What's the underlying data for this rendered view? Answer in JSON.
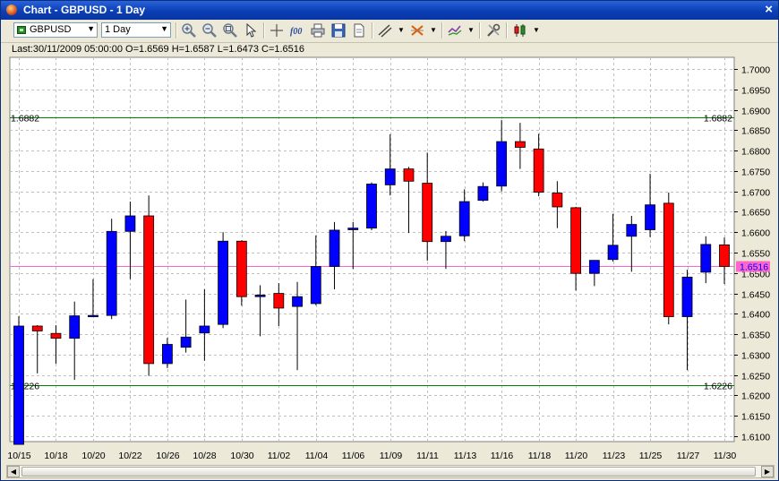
{
  "window": {
    "title": "Chart - GBPUSD - 1 Day",
    "close_label": "×"
  },
  "toolbar": {
    "symbol": "GBPUSD",
    "period": "1 Day",
    "tools": [
      "zoom-in-icon",
      "zoom-out-icon",
      "zoom-fit-icon",
      "cursor-pointer-icon",
      "crosshair-icon",
      "function-icon",
      "print-icon",
      "save-icon",
      "document-icon",
      "trendline-icon",
      "fibonacci-icon",
      "indicators-icon",
      "settings-icon",
      "chart-type-icon"
    ]
  },
  "info": {
    "text": "Last:30/11/2009 05:00:00 O=1.6569 H=1.6587 L=1.6473 C=1.6516"
  },
  "colors": {
    "bull": "#0000ff",
    "bear": "#ff0000",
    "hline": "#008000",
    "price_line": "#ff66cc",
    "price_label_bg": "#ff66cc",
    "price_label_text": "#0000ff",
    "grid": "#c0c0c0"
  },
  "chart_data": {
    "type": "candlestick",
    "symbol": "GBPUSD",
    "period": "1 Day",
    "ylim": [
      1.6082,
      1.7035
    ],
    "yticks": [
      "1.7000",
      "1.6950",
      "1.6900",
      "1.6850",
      "1.6800",
      "1.6750",
      "1.6700",
      "1.6650",
      "1.6600",
      "1.6550",
      "1.6500",
      "1.6450",
      "1.6400",
      "1.6350",
      "1.6300",
      "1.6250",
      "1.6200",
      "1.6150",
      "1.6100"
    ],
    "xlabels": [
      "10/15",
      "10/18",
      "10/20",
      "10/22",
      "10/26",
      "10/28",
      "10/30",
      "11/02",
      "11/04",
      "11/06",
      "11/09",
      "11/11",
      "11/13",
      "11/16",
      "11/18",
      "11/20",
      "11/23",
      "11/25",
      "11/27",
      "11/30"
    ],
    "horizontal_lines": [
      {
        "value": 1.6882,
        "label": "1.6882"
      },
      {
        "value": 1.6226,
        "label": "1.6226"
      }
    ],
    "last_price": {
      "value": 1.6516,
      "label": "1.6516"
    },
    "candles": [
      {
        "o": 1.608,
        "h": 1.6394,
        "l": 1.608,
        "c": 1.637
      },
      {
        "o": 1.637,
        "h": 1.6372,
        "l": 1.6254,
        "c": 1.6358
      },
      {
        "o": 1.6352,
        "h": 1.6372,
        "l": 1.6278,
        "c": 1.634
      },
      {
        "o": 1.634,
        "h": 1.643,
        "l": 1.6238,
        "c": 1.6395
      },
      {
        "o": 1.6394,
        "h": 1.6485,
        "l": 1.6394,
        "c": 1.6396
      },
      {
        "o": 1.6396,
        "h": 1.6633,
        "l": 1.6387,
        "c": 1.6602
      },
      {
        "o": 1.6602,
        "h": 1.6675,
        "l": 1.6485,
        "c": 1.664
      },
      {
        "o": 1.664,
        "h": 1.669,
        "l": 1.6248,
        "c": 1.6278
      },
      {
        "o": 1.6278,
        "h": 1.6341,
        "l": 1.6267,
        "c": 1.6325
      },
      {
        "o": 1.6318,
        "h": 1.6435,
        "l": 1.6305,
        "c": 1.6343
      },
      {
        "o": 1.6353,
        "h": 1.646,
        "l": 1.6285,
        "c": 1.637
      },
      {
        "o": 1.6374,
        "h": 1.66,
        "l": 1.6365,
        "c": 1.6578
      },
      {
        "o": 1.6578,
        "h": 1.658,
        "l": 1.642,
        "c": 1.6442
      },
      {
        "o": 1.6442,
        "h": 1.647,
        "l": 1.6345,
        "c": 1.6446
      },
      {
        "o": 1.645,
        "h": 1.6475,
        "l": 1.637,
        "c": 1.6414
      },
      {
        "o": 1.6418,
        "h": 1.6478,
        "l": 1.6262,
        "c": 1.6442
      },
      {
        "o": 1.6425,
        "h": 1.6592,
        "l": 1.6421,
        "c": 1.6516
      },
      {
        "o": 1.6516,
        "h": 1.6625,
        "l": 1.646,
        "c": 1.6605
      },
      {
        "o": 1.6606,
        "h": 1.6625,
        "l": 1.651,
        "c": 1.661
      },
      {
        "o": 1.661,
        "h": 1.6722,
        "l": 1.6605,
        "c": 1.6718
      },
      {
        "o": 1.6716,
        "h": 1.684,
        "l": 1.669,
        "c": 1.6755
      },
      {
        "o": 1.6755,
        "h": 1.676,
        "l": 1.6598,
        "c": 1.6725
      },
      {
        "o": 1.672,
        "h": 1.6795,
        "l": 1.653,
        "c": 1.6577
      },
      {
        "o": 1.6577,
        "h": 1.6603,
        "l": 1.651,
        "c": 1.659
      },
      {
        "o": 1.6591,
        "h": 1.6705,
        "l": 1.6578,
        "c": 1.6675
      },
      {
        "o": 1.6678,
        "h": 1.6722,
        "l": 1.6675,
        "c": 1.6712
      },
      {
        "o": 1.6713,
        "h": 1.6875,
        "l": 1.67,
        "c": 1.6822
      },
      {
        "o": 1.6822,
        "h": 1.6868,
        "l": 1.6755,
        "c": 1.6808
      },
      {
        "o": 1.6804,
        "h": 1.6841,
        "l": 1.6688,
        "c": 1.6698
      },
      {
        "o": 1.6696,
        "h": 1.6725,
        "l": 1.661,
        "c": 1.6662
      },
      {
        "o": 1.666,
        "h": 1.6662,
        "l": 1.6457,
        "c": 1.6499
      },
      {
        "o": 1.6499,
        "h": 1.653,
        "l": 1.6468,
        "c": 1.6531
      },
      {
        "o": 1.6533,
        "h": 1.6645,
        "l": 1.6528,
        "c": 1.6568
      },
      {
        "o": 1.659,
        "h": 1.664,
        "l": 1.6503,
        "c": 1.6619
      },
      {
        "o": 1.6606,
        "h": 1.6743,
        "l": 1.6588,
        "c": 1.6667
      },
      {
        "o": 1.6671,
        "h": 1.6697,
        "l": 1.6374,
        "c": 1.6393
      },
      {
        "o": 1.6393,
        "h": 1.6508,
        "l": 1.6262,
        "c": 1.649
      },
      {
        "o": 1.6502,
        "h": 1.659,
        "l": 1.6475,
        "c": 1.657
      },
      {
        "o": 1.6569,
        "h": 1.6587,
        "l": 1.6473,
        "c": 1.6516
      }
    ]
  }
}
